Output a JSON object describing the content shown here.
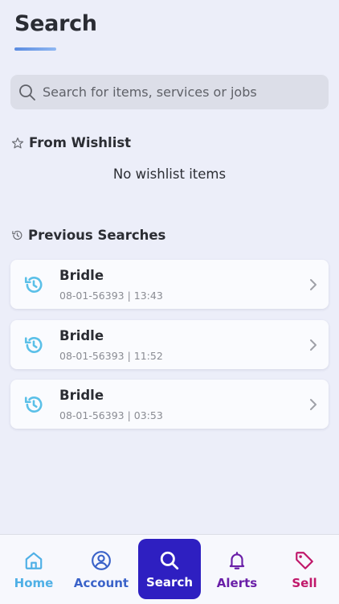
{
  "header": {
    "title": "Search"
  },
  "search": {
    "placeholder": "Search for items, services or jobs"
  },
  "wishlist": {
    "heading": "From Wishlist",
    "empty_text": "No wishlist items"
  },
  "previous": {
    "heading": "Previous Searches",
    "items": [
      {
        "title": "Bridle",
        "subtitle": "08-01-56393 | 13:43"
      },
      {
        "title": "Bridle",
        "subtitle": "08-01-56393 | 11:52"
      },
      {
        "title": "Bridle",
        "subtitle": "08-01-56393 | 03:53"
      }
    ]
  },
  "nav": {
    "items": [
      {
        "label": "Home",
        "icon": "home-icon",
        "color": "#4fb0e6"
      },
      {
        "label": "Account",
        "icon": "user-icon",
        "color": "#3b63c9"
      },
      {
        "label": "Search",
        "icon": "search-icon",
        "color": "#ffffff",
        "active": true
      },
      {
        "label": "Alerts",
        "icon": "bell-icon",
        "color": "#6a1fa8"
      },
      {
        "label": "Sell",
        "icon": "tag-icon",
        "color": "#c0186a"
      }
    ]
  },
  "colors": {
    "background": "#eceef9",
    "accent_active": "#2e1fc1",
    "history_icon": "#5bc0e8"
  }
}
